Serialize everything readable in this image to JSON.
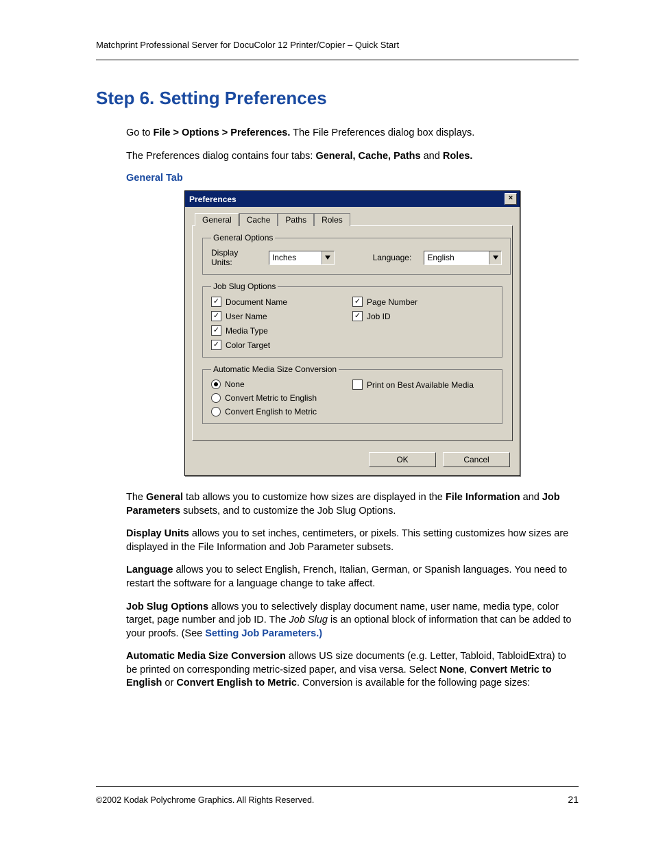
{
  "header": "Matchprint Professional Server for DocuColor 12 Printer/Copier – Quick Start",
  "title": "Step 6. Setting Preferences",
  "intro_pre": "Go to ",
  "intro_bold": "File > Options > Preferences.",
  "intro_post": "  The File Preferences dialog box displays.",
  "tabs_sentence_pre": "The Preferences dialog contains four tabs: ",
  "tabs_sentence_bold": "General, Cache, Paths",
  "tabs_sentence_mid": " and ",
  "tabs_sentence_bold2": "Roles.",
  "subhead_general_tab": "General Tab",
  "dialog": {
    "title": "Preferences",
    "close_glyph": "×",
    "tabs": [
      "General",
      "Cache",
      "Paths",
      "Roles"
    ],
    "general_options": {
      "legend": "General Options",
      "display_units_label": "Display Units:",
      "display_units_value": "Inches",
      "language_label": "Language:",
      "language_value": "English"
    },
    "job_slug": {
      "legend": "Job Slug Options",
      "left": [
        "Document Name",
        "User Name",
        "Media Type",
        "Color Target"
      ],
      "right": [
        "Page Number",
        "Job ID"
      ]
    },
    "auto_media": {
      "legend": "Automatic Media Size Conversion",
      "radios": [
        "None",
        "Convert Metric to English",
        "Convert English to Metric"
      ],
      "best_media": "Print on Best Available Media"
    },
    "ok": "OK",
    "cancel": "Cancel"
  },
  "p_general_1a": "The ",
  "p_general_1b": "General",
  "p_general_1c": " tab allows you to customize how sizes are displayed in the ",
  "p_general_1d": "File Information",
  "p_general_1e": " and ",
  "p_general_1f": "Job Parameters",
  "p_general_1g": " subsets, and to customize the Job Slug Options.",
  "p_du_b": "Display Units",
  "p_du_t": " allows you to set inches, centimeters, or pixels. This setting customizes how sizes are displayed in the File Information and Job Parameter subsets.",
  "p_lang_b": "Language",
  "p_lang_t": " allows you to select English, French, Italian, German, or Spanish languages. You need to restart the software for a language change to take affect.",
  "p_js_b": "Job Slug Options",
  "p_js_t1": " allows you to selectively display document name, user name, media type, color target, page number and job ID. The ",
  "p_js_i": "Job Slug",
  "p_js_t2": " is an optional block of information that can be added to your proofs. (See ",
  "p_js_link": "Setting Job Parameters.)",
  "p_am_b": "Automatic Media Size Conversion",
  "p_am_t1": " allows US size documents (e.g. Letter, Tabloid, TabloidExtra) to be printed on corresponding metric-sized paper, and visa versa. Select ",
  "p_am_b2": "None",
  "p_am_t2": ", ",
  "p_am_b3": "Convert Metric to English",
  "p_am_t3": " or ",
  "p_am_b4": "Convert English to Metric",
  "p_am_t4": ". Conversion is available for the following page sizes:",
  "footer": "©2002 Kodak Polychrome Graphics. All Rights Reserved.",
  "page_number": "21"
}
